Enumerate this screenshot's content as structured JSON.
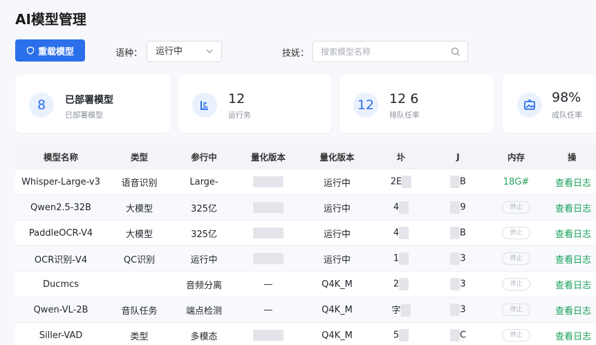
{
  "page": {
    "title": "AI模型管理"
  },
  "toolbar": {
    "reload_label": "重载模型",
    "language_label": "语种：",
    "language_value": "运行中",
    "search_label": "技妩：",
    "search_placeholder": "搜索模型名称"
  },
  "stats": [
    {
      "badge": "8",
      "main": "已部署模型",
      "sub": "已部署模型"
    },
    {
      "badge_icon": "deploy-icon",
      "main": "12",
      "sub": "运行务"
    },
    {
      "badge": "12",
      "main": "12 6",
      "sub": "排队任率"
    },
    {
      "badge_icon": "image-icon",
      "main": "98%",
      "sub": "成队任率"
    }
  ],
  "table": {
    "headers": [
      "模型名称",
      "类型",
      "参行中",
      "量化版本",
      "量化版本",
      "圤",
      "J",
      "内存",
      "操"
    ],
    "rows": [
      {
        "name": "Whisper-Large-v3",
        "type": "语音识别",
        "param": "Large-",
        "quant": "",
        "status": "运行中",
        "c6": "2E",
        "c7": "B",
        "mem": "18G#",
        "mem_green": true,
        "action": "查看日志"
      },
      {
        "name": "Qwen2.5-32B",
        "type": "大模型",
        "param": "325亿",
        "quant": "",
        "status": "运行中",
        "c6": "4",
        "c7": "9",
        "mem": "停止",
        "mem_green": false,
        "action": "查看日志"
      },
      {
        "name": "PaddleOCR-V4",
        "type": "大模型",
        "param": "325亿",
        "quant": "",
        "status": "运行中",
        "c6": "4",
        "c7": "B",
        "mem": "停止",
        "mem_green": false,
        "action": "查看日志"
      },
      {
        "name": "OCR识别-V4",
        "type": "QC识别",
        "param": "运行中",
        "quant": "",
        "status": "运行中",
        "c6": "1",
        "c7": "3",
        "mem": "停止",
        "mem_green": false,
        "action": "查看日志"
      },
      {
        "name": "Ducmcs",
        "type": "",
        "param": "音频分离",
        "quant": "—",
        "status": "Q4K_M",
        "c6": "2",
        "c7": "3",
        "mem": "停止",
        "mem_green": false,
        "action": "查看日志"
      },
      {
        "name": "Qwen-VL-2B",
        "type": "音队任务",
        "param": "端点检测",
        "quant": "—",
        "status": "Q4K_M",
        "c6": "字",
        "c7": "3",
        "mem": "停止",
        "mem_green": false,
        "action": "查看日志"
      },
      {
        "name": "Siller-VAD",
        "type": "类型",
        "param": "多模态",
        "quant": "",
        "status": "Q4K_M",
        "c6": "5",
        "c7": "C",
        "mem": "停止",
        "mem_green": false,
        "action": "查看日志"
      }
    ]
  },
  "colors": {
    "accent": "#2b6fea",
    "success": "#22a35a",
    "link": "#16a05a"
  }
}
